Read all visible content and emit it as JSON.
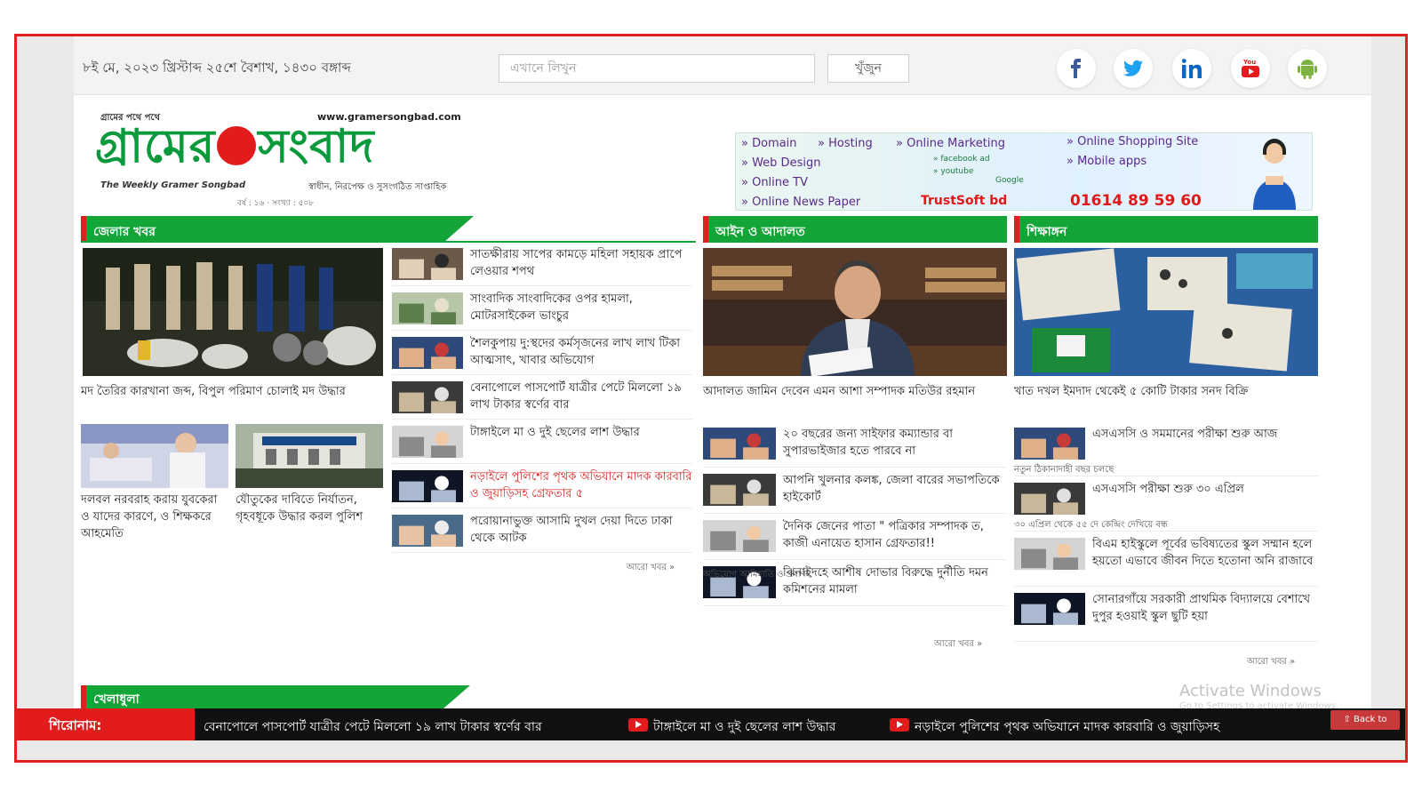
{
  "topbar": {
    "date": "৮ই মে, ২০২৩ খ্রিস্টাব্দ ২৫শে বৈশাখ, ১৪৩০ বঙ্গাব্দ",
    "search_placeholder": "এখানে লিখুন",
    "search_button": "খুঁজুন",
    "social_icons": [
      "facebook-icon",
      "twitter-icon",
      "linkedin-icon",
      "youtube-icon",
      "android-icon"
    ]
  },
  "logo": {
    "tagline_small": "গ্রামের পথে পথে",
    "url": "www.gramersongbad.com",
    "name_left": "গ্রামের",
    "name_right": "সংবাদ",
    "sub_en": "The Weekly Gramer Songbad",
    "sub_bn": "স্বাধীন, নিরপেক্ষ ও সুসংগঠিত সাপ্তাহিক",
    "meta": "বর্ষ : ১৬  ·  সংখ্যা : ৫০৮"
  },
  "ad": {
    "items": [
      "» Domain",
      "» Hosting",
      "» Online Marketing",
      "» Online Shopping Site",
      "» Web Design",
      "» Mobile apps",
      "» Online TV",
      "» Online News Paper"
    ],
    "sub1": "» facebook ad",
    "sub2": "» youtube",
    "sub3": "Google",
    "brand": "TrustSoft bd",
    "phone": "01614 89 59 60"
  },
  "sections": {
    "district": {
      "title": "জেলার খবর",
      "lead": "মদ তৈরির কারখানা জব্দ, বিপুল পরিমাণ চোলাই মদ উদ্ধার",
      "sub1": "দলবল নরবরাহ করায় যুবকেরা ও যাদের কারণে, ও শিক্ষকরে আহমেতি",
      "sub2": "যৌতুকের দাবিতে নির্যাতন, গৃহবধূকে উদ্ধার করল পুলিশ",
      "list": [
        {
          "text": "সাতক্ষীরায় সাপের কামড়ে মহিলা সহায়ক প্রাপে লেওয়ার শপথ",
          "red": false
        },
        {
          "text": "সাংবাদিক সাংবাদিকের ওপর হামলা, মোটরসাইকেল ভাংচুর",
          "red": false
        },
        {
          "text": "শৈলকুপায় দু:স্থদের কর্মসৃজনের লাখ লাখ টিকা আত্মসাৎ, খাবার অভিযোগ",
          "red": false
        },
        {
          "text": "বেনাপোলে পাসপোর্ট যাত্রীর পেটে মিললো ১৯ লাখ টাকার স্বর্ণের বার",
          "red": false
        },
        {
          "text": "টাঙ্গাইলে মা ও দুই ছেলের লাশ উদ্ধার",
          "red": false
        },
        {
          "text": "নড়াইলে পুলিশের পৃথক অভিযানে মাদক কারবারি ও জুয়াড়িসহ গ্রেফতার ৫",
          "red": true
        },
        {
          "text": "পরোয়ানাভুক্ত আসামি দুখল দেয়া দিতে ঢাকা থেকে আটক",
          "red": false
        }
      ],
      "more": "আরো খবর »"
    },
    "law": {
      "title": "আইন ও আদালত",
      "lead": "আদালত জামিন দেবেন এমন আশা সম্পাদক মতিউর রহমান",
      "list": [
        {
          "text": "২০ বছরের জন্য সাইফার কম্যান্ডার বা সুপারভাইজার হতে পারবে না"
        },
        {
          "text": "আপনি খুলনার কলঙ্ক, জেলা বারের সভাপতিকে হাইকোর্ট"
        },
        {
          "text": "দৈনিক জেনের পাতা \" পত্রিকার সম্পাদক ত, কাজী এনায়েত হাসান গ্রেফতার!!"
        },
        {
          "text": "ঝিনাইদহে আশীষ দোভার বিরুদ্ধে দুর্নীতি দমন কমিশনের মামলা"
        }
      ],
      "meta": "অভিযোগ আমিহাতি ও প্রমাণহ",
      "more": "আরো খবর »"
    },
    "edu": {
      "title": "শিক্ষাঙ্গন",
      "lead": "খাত দখল ইমদাদ থেকেই ৫ কোটি টাকার সনদ বিক্রি",
      "list": [
        {
          "text": "এসএসসি ও সমমানের পরীক্ষা শুরু আজ",
          "meta": "নতুন ঠিকানাদাহী বছর চলছে"
        },
        {
          "text": "এসএসসি পরীক্ষা শুরু ৩০ এপ্রিল",
          "meta": "৩০ এপ্রিল থেকে ৫৫ দে কেন্দ্রিং দেখিয়ে বন্ধ"
        },
        {
          "text": "বিএম হাইস্কুলে পূর্বের ভবিষ্যতের স্কুল সম্মান হলে হয়তো এভাবে জীবন দিতে হতোনা অনি রাজাবে"
        },
        {
          "text": "সোনারগাঁয়ে সরকারী প্রাথমিক বিদ্যালয়ে বেশাখে দুপুর হওয়াই স্কুল ছুটি হয়া"
        }
      ],
      "more": "আরো খবর »"
    },
    "sports": {
      "title": "খেলাধুলা"
    }
  },
  "ticker": {
    "label": "শিরোনাম:",
    "items": [
      "বেনাপোলে পাসপোর্ট যাত্রীর পেটে মিললো ১৯ লাখ টাকার স্বর্ণের বার",
      "টাঙ্গাইলে মা ও দুই ছেলের লাশ উদ্ধার",
      "নড়াইলে পুলিশের পৃথক অভিযানে মাদক কারবারি ও জুয়াড়িসহ"
    ],
    "back_to_top": "⇧ Back to"
  },
  "watermark": {
    "line1": "Activate Windows",
    "line2": "Go to Settings to activate Windows."
  },
  "colors": {
    "green": "#13a538",
    "red": "#e02020",
    "frame": "#e02020"
  }
}
